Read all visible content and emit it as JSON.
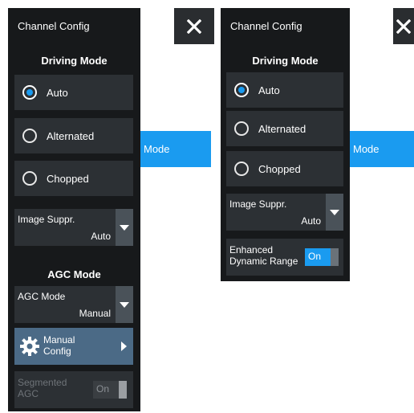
{
  "left_panel": {
    "title": "Channel Config",
    "driving_mode": {
      "heading": "Driving Mode",
      "options": [
        {
          "label": "Auto",
          "selected": true
        },
        {
          "label": "Alternated",
          "selected": false
        },
        {
          "label": "Chopped",
          "selected": false
        }
      ]
    },
    "image_suppr": {
      "label": "Image Suppr.",
      "value": "Auto"
    },
    "agc": {
      "heading": "AGC Mode",
      "dropdown_label": "AGC Mode",
      "dropdown_value": "Manual",
      "manual_config_line1": "Manual",
      "manual_config_line2": "Config",
      "segmented_line1": "Segmented",
      "segmented_line2": "AGC",
      "segmented_toggle": "On"
    },
    "side_tag": "Mode"
  },
  "right_panel": {
    "title": "Channel Config",
    "driving_mode": {
      "heading": "Driving Mode",
      "options": [
        {
          "label": "Auto",
          "selected": true
        },
        {
          "label": "Alternated",
          "selected": false
        },
        {
          "label": "Chopped",
          "selected": false
        }
      ]
    },
    "image_suppr": {
      "label": "Image Suppr.",
      "value": "Auto"
    },
    "enhanced_line1": "Enhanced",
    "enhanced_line2": "Dynamic Range",
    "enhanced_toggle": "On",
    "side_tag": "Mode"
  },
  "colors": {
    "accent": "#1a9bf0",
    "panel": "#17191b",
    "control": "#2c3034",
    "config_button": "#4b6a86"
  },
  "icons": [
    "close-icon",
    "gear-icon",
    "chevron-down-icon",
    "chevron-right-icon"
  ]
}
